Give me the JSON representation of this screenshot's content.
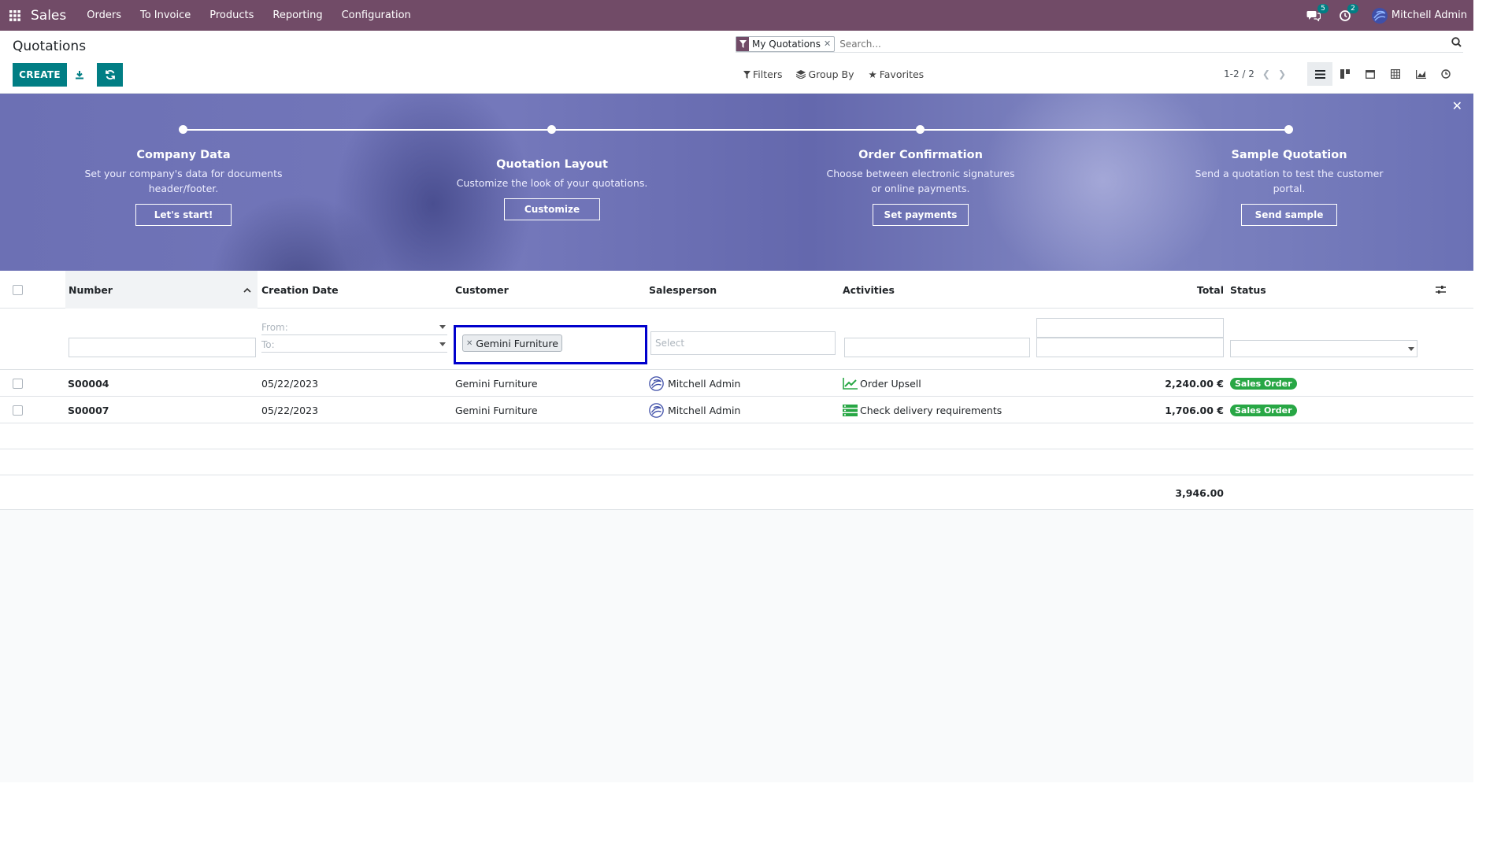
{
  "nav": {
    "app_name": "Sales",
    "menus": [
      "Orders",
      "To Invoice",
      "Products",
      "Reporting",
      "Configuration"
    ],
    "messages_count": "5",
    "activities_count": "2",
    "user": "Mitchell Admin"
  },
  "control": {
    "title": "Quotations",
    "create_label": "CREATE",
    "facet": "My Quotations",
    "search_placeholder": "Search...",
    "filters_label": "Filters",
    "groupby_label": "Group By",
    "favorites_label": "Favorites",
    "pager": "1-2 / 2"
  },
  "banner": {
    "steps": [
      {
        "title": "Company Data",
        "desc1": "Set your company's data for documents",
        "desc2": "header/footer.",
        "button": "Let's start!"
      },
      {
        "title": "Quotation Layout",
        "desc1": "Customize the look of your quotations.",
        "desc2": "",
        "button": "Customize"
      },
      {
        "title": "Order Confirmation",
        "desc1": "Choose between electronic signatures",
        "desc2": "or online payments.",
        "button": "Set payments"
      },
      {
        "title": "Sample Quotation",
        "desc1": "Send a quotation to test the customer",
        "desc2": "portal.",
        "button": "Send sample"
      }
    ]
  },
  "table": {
    "headers": {
      "number": "Number",
      "creation_date": "Creation Date",
      "customer": "Customer",
      "salesperson": "Salesperson",
      "activities": "Activities",
      "total": "Total",
      "status": "Status"
    },
    "filter": {
      "date_from": "From:",
      "date_to": "To:",
      "customer_tag": "Gemini Furniture",
      "salesperson_placeholder": "Select"
    },
    "rows": [
      {
        "number": "S00004",
        "date": "05/22/2023",
        "customer": "Gemini Furniture",
        "salesperson": "Mitchell Admin",
        "activity": "Order Upsell",
        "total": "2,240.00 €",
        "status": "Sales Order"
      },
      {
        "number": "S00007",
        "date": "05/22/2023",
        "customer": "Gemini Furniture",
        "salesperson": "Mitchell Admin",
        "activity": "Check delivery requirements",
        "total": "1,706.00 €",
        "status": "Sales Order"
      }
    ],
    "grand_total": "3,946.00"
  },
  "colors": {
    "brand": "#714b67",
    "accent": "#017e84",
    "success": "#28a745",
    "focus": "#0000cc"
  }
}
